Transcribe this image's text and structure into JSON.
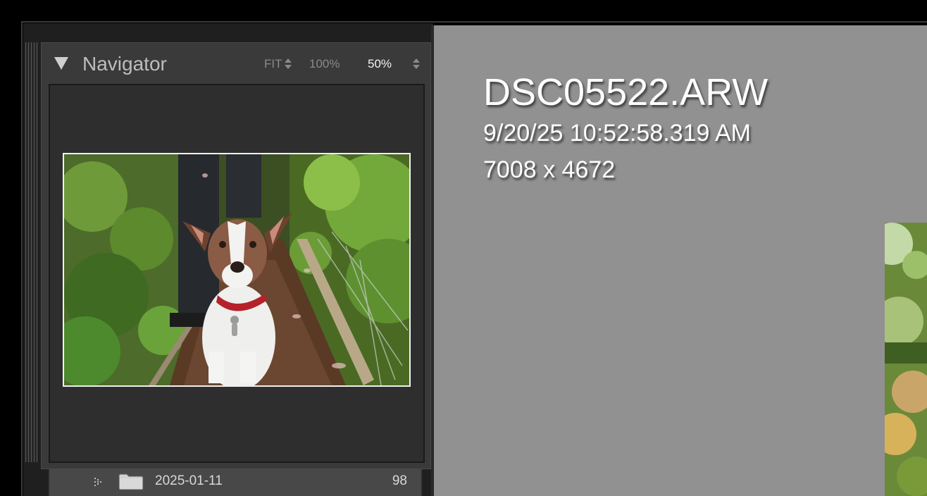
{
  "navigator": {
    "title": "Navigator",
    "zoom_options": [
      "FIT",
      "100%",
      "50%"
    ],
    "active_zoom": "50%"
  },
  "folder": {
    "name": "2025-01-11",
    "count": "98"
  },
  "photo_info": {
    "filename": "DSC05522.ARW",
    "datetime": "9/20/25 10:52:58.319 AM",
    "dimensions": "7008 x 4672"
  },
  "colors": {
    "main_background": "#919191",
    "panel_background": "#3a3a3a",
    "active_text": "#f2f2f2"
  },
  "icons": [
    "collapse-triangle-icon",
    "updown-arrow-icon",
    "folder-icon",
    "subfolder-dots-icon"
  ]
}
